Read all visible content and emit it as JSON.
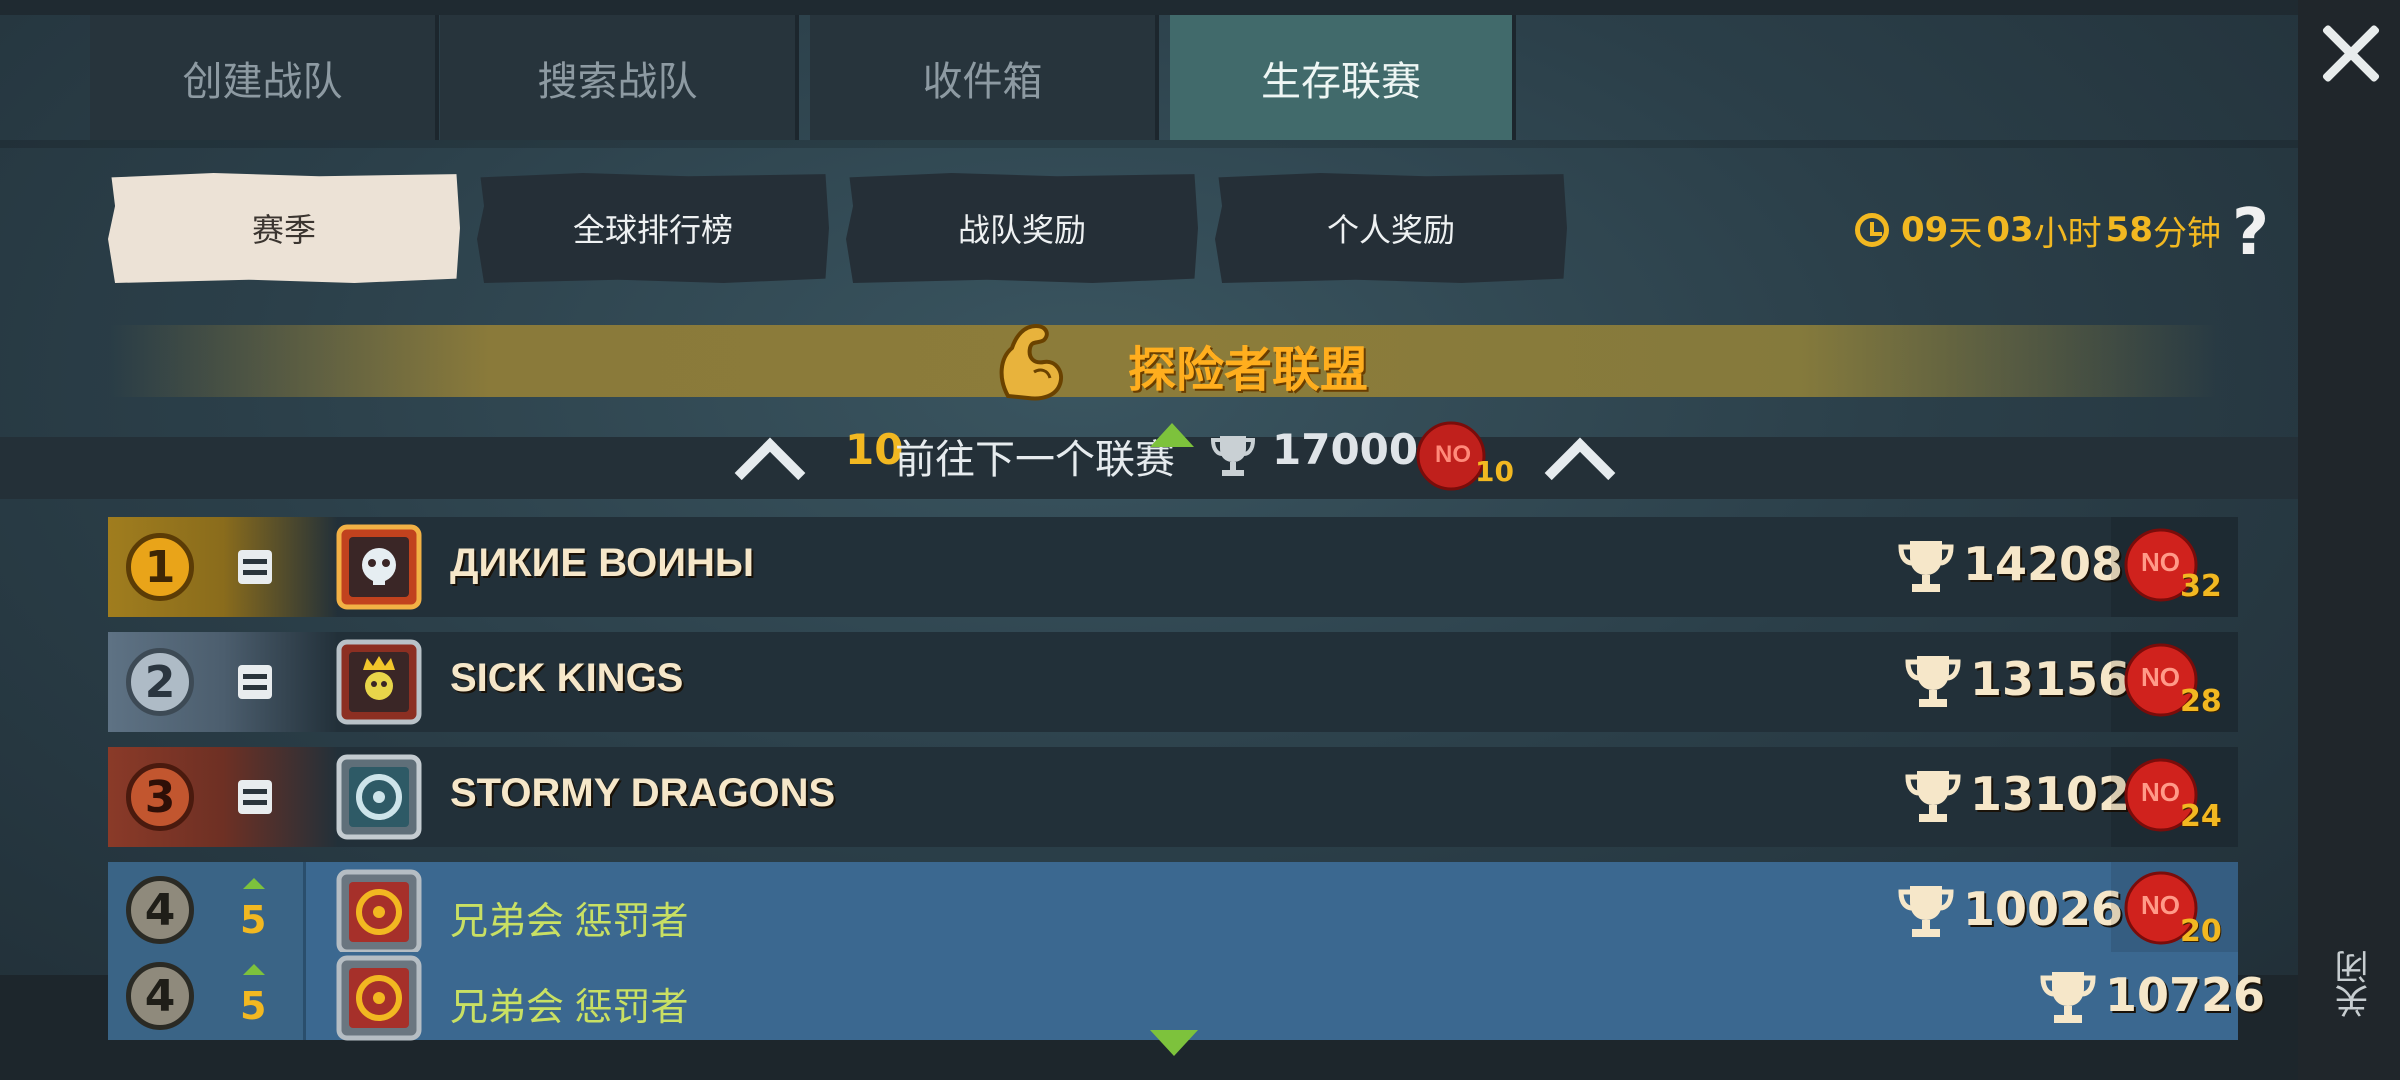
{
  "top_tabs": [
    {
      "label": "创建战队"
    },
    {
      "label": "搜索战队"
    },
    {
      "label": "收件箱"
    },
    {
      "label": "生存联赛",
      "active": true
    }
  ],
  "sub_tabs": [
    {
      "label": "赛季",
      "active": true
    },
    {
      "label": "全球排行榜"
    },
    {
      "label": "战队奖励"
    },
    {
      "label": "个人奖励"
    }
  ],
  "timer": {
    "days": "09",
    "days_unit": "天",
    "hours": "03",
    "hours_unit": "小时",
    "minutes": "58",
    "minutes_unit": "分钟"
  },
  "help_label": "?",
  "close_label": "关闭",
  "league": {
    "name": "探险者联盟"
  },
  "promotion": {
    "count": "10",
    "text": "前往下一个联赛",
    "score": "17000",
    "token_count": "10"
  },
  "rows": [
    {
      "rank": "1",
      "change": "=",
      "name": "ДИКИЕ ВОИНЫ",
      "score": "14208",
      "tokens": "32"
    },
    {
      "rank": "2",
      "change": "=",
      "name": "SICK KINGS",
      "score": "13156",
      "tokens": "28"
    },
    {
      "rank": "3",
      "change": "=",
      "name": "STORMY DRAGONS",
      "score": "13102",
      "tokens": "24"
    },
    {
      "rank": "4",
      "change": "5",
      "name": "兄弟会 惩罚者",
      "score": "10026",
      "tokens": "20"
    },
    {
      "rank": "4",
      "change": "5",
      "name": "兄弟会 惩罚者",
      "score": "10726"
    }
  ],
  "colors": {
    "accent": "#f2b821",
    "active_tab": "#416a6b",
    "highlight_row": "#3b6890",
    "green": "#7dc23c"
  }
}
